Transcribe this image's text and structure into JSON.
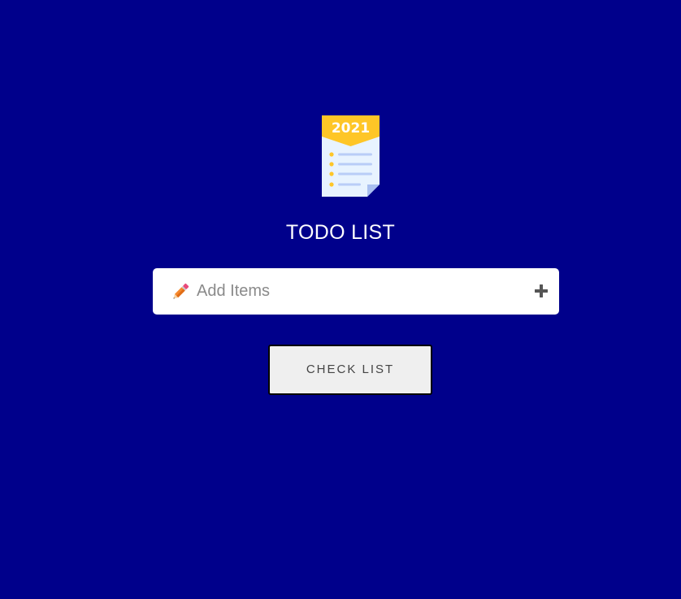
{
  "header": {
    "logo_year": "2021",
    "logo_icon": "notepad-checklist-icon",
    "title": "TODO LIST"
  },
  "add_item": {
    "placeholder": "Add Items",
    "value": "",
    "leading_icon": "pencil-icon",
    "action_icon": "plus-icon"
  },
  "check_list_button": {
    "label": "CHECK LIST"
  },
  "colors": {
    "background": "#00008b",
    "card": "#ffffff",
    "logo_banner": "#fec627",
    "button_bg": "#efefef",
    "plus_icon": "#555555"
  }
}
